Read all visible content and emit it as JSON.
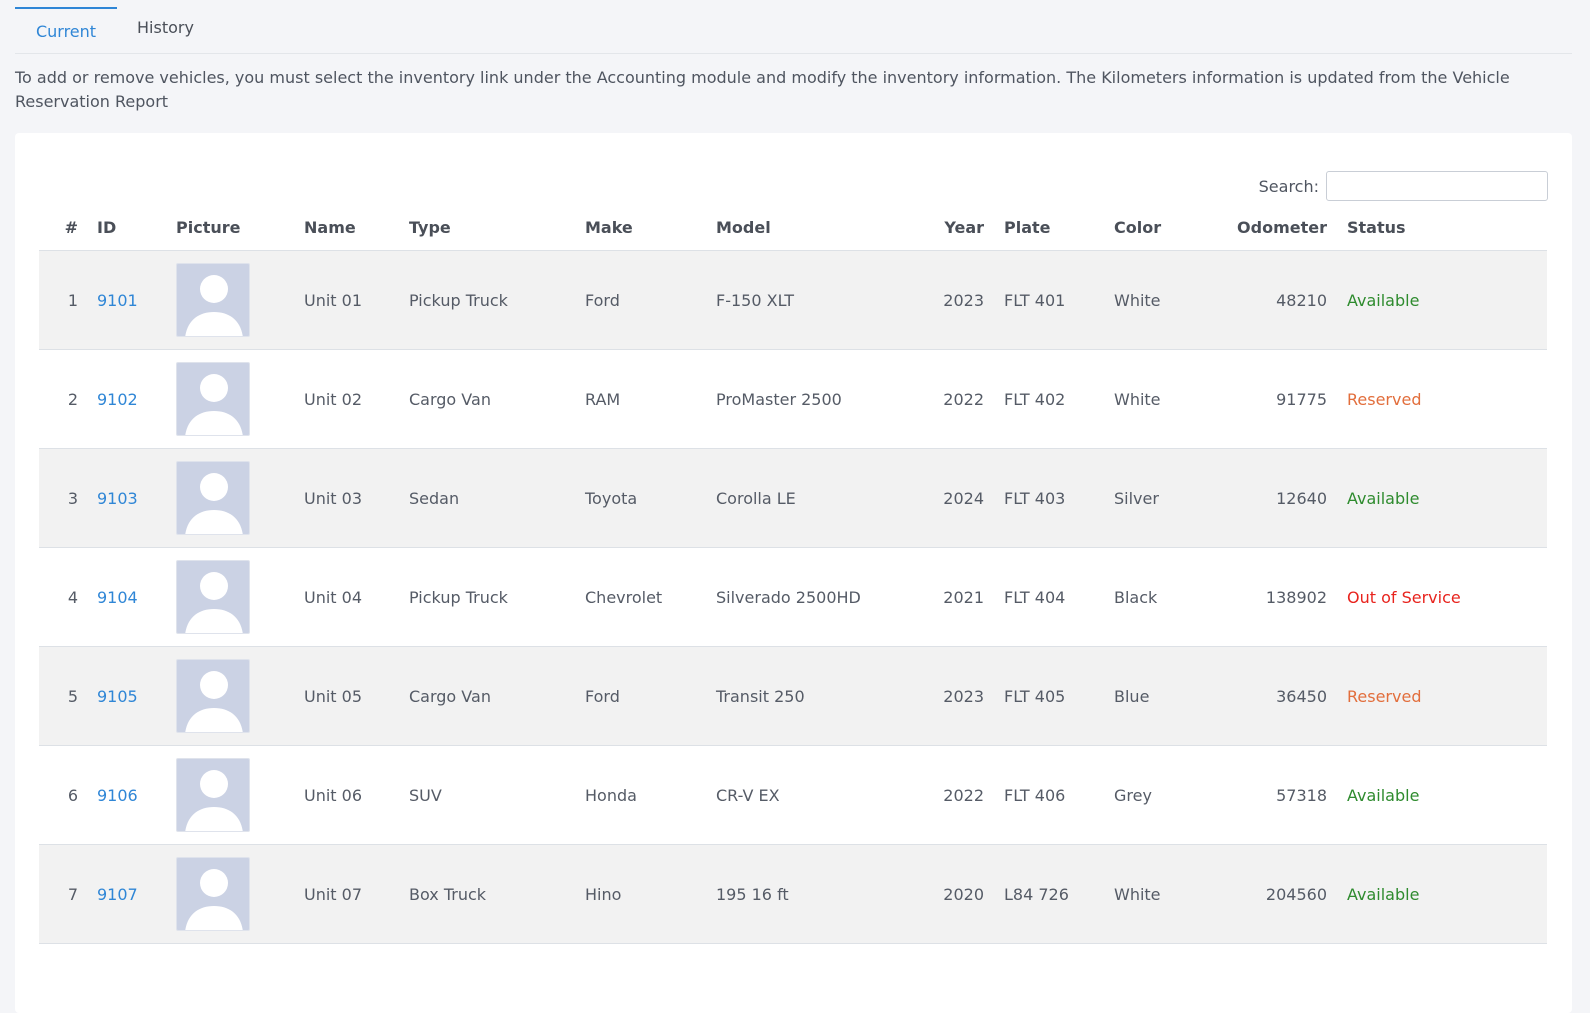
{
  "tabs": [
    {
      "label": "Current",
      "active": true
    },
    {
      "label": "History",
      "active": false
    }
  ],
  "notice": "To add or remove vehicles, you must select the inventory link under the Accounting module and modify the inventory information. The Kilometers information is updated from the Vehicle Reservation Report",
  "search": {
    "label": "Search:",
    "value": ""
  },
  "columns": [
    "#",
    "ID",
    "Picture",
    "Name",
    "Type",
    "Make",
    "Model",
    "Year",
    "Plate",
    "Color",
    "Odometer",
    "Status"
  ],
  "status_colors": {
    "Available": "#2e8b2e",
    "Reserved": "#e26e3c",
    "Out of Service": "#e8231d"
  },
  "rows": [
    {
      "n": "1",
      "id": "9101",
      "name": "Unit 01",
      "type": "Pickup Truck",
      "make": "Ford",
      "model": "F-150 XLT",
      "year": "2023",
      "plate": "FLT 401",
      "color": "White",
      "odometer": "48210",
      "status": "Available"
    },
    {
      "n": "2",
      "id": "9102",
      "name": "Unit 02",
      "type": "Cargo Van",
      "make": "RAM",
      "model": "ProMaster 2500",
      "year": "2022",
      "plate": "FLT 402",
      "color": "White",
      "odometer": "91775",
      "status": "Reserved"
    },
    {
      "n": "3",
      "id": "9103",
      "name": "Unit 03",
      "type": "Sedan",
      "make": "Toyota",
      "model": "Corolla LE",
      "year": "2024",
      "plate": "FLT 403",
      "color": "Silver",
      "odometer": "12640",
      "status": "Available"
    },
    {
      "n": "4",
      "id": "9104",
      "name": "Unit 04",
      "type": "Pickup Truck",
      "make": "Chevrolet",
      "model": "Silverado 2500HD",
      "year": "2021",
      "plate": "FLT 404",
      "color": "Black",
      "odometer": "138902",
      "status": "Out of Service"
    },
    {
      "n": "5",
      "id": "9105",
      "name": "Unit 05",
      "type": "Cargo Van",
      "make": "Ford",
      "model": "Transit 250",
      "year": "2023",
      "plate": "FLT 405",
      "color": "Blue",
      "odometer": "36450",
      "status": "Reserved"
    },
    {
      "n": "6",
      "id": "9106",
      "name": "Unit 06",
      "type": "SUV",
      "make": "Honda",
      "model": "CR-V EX",
      "year": "2022",
      "plate": "FLT 406",
      "color": "Grey",
      "odometer": "57318",
      "status": "Available"
    },
    {
      "n": "7",
      "id": "9107",
      "name": "Unit 07",
      "type": "Box Truck",
      "make": "Hino",
      "model": "195 16 ft",
      "year": "2020",
      "plate": "L84 726",
      "color": "White",
      "odometer": "204560",
      "status": "Available"
    }
  ]
}
